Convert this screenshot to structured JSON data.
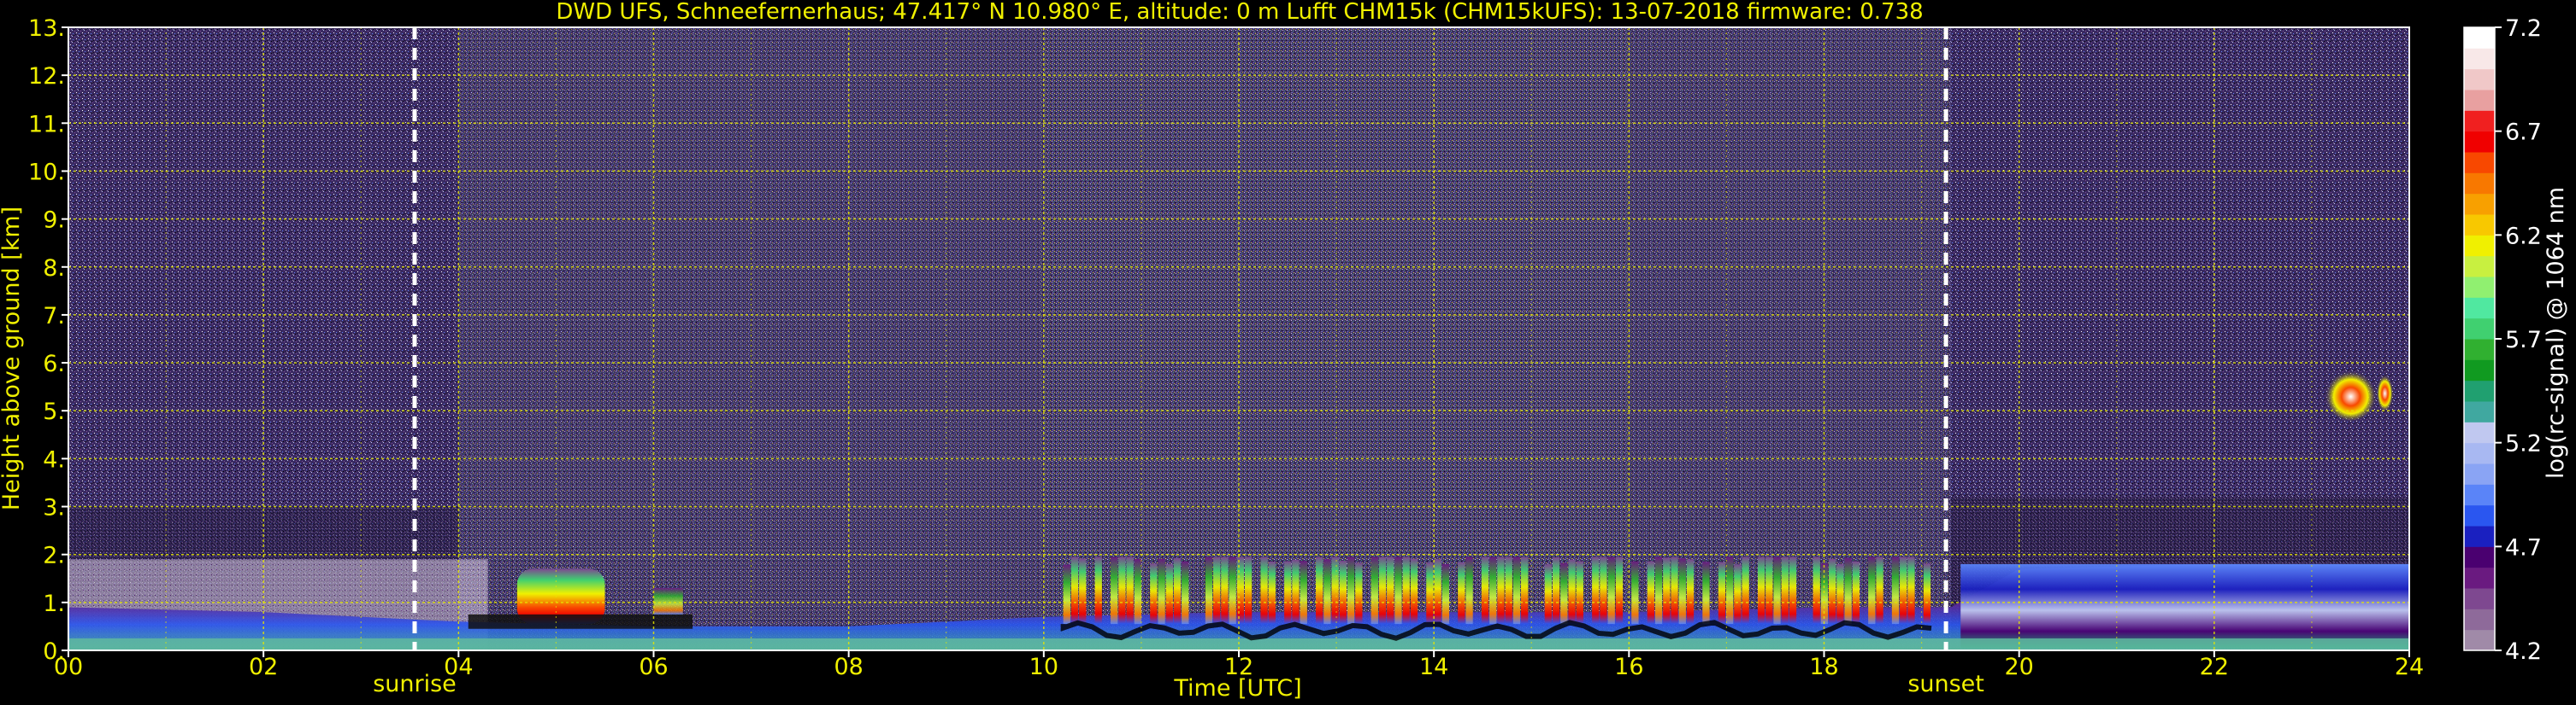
{
  "chart_data": {
    "type": "heatmap",
    "title": "DWD UFS, Schneefernerhaus; 47.417° N 10.980° E, altitude: 0 m    Lufft CHM15k (CHM15kUFS): 13-07-2018    firmware: 0.738",
    "xlabel": "Time [UTC]",
    "ylabel": "Height above ground [km]",
    "xlim": [
      0,
      24
    ],
    "ylim": [
      0,
      13
    ],
    "x_ticks": [
      0,
      2,
      4,
      6,
      8,
      10,
      12,
      14,
      16,
      18,
      20,
      22,
      24
    ],
    "x_tick_labels": [
      "00",
      "02",
      "04",
      "06",
      "08",
      "10",
      "12",
      "14",
      "16",
      "18",
      "20",
      "22",
      "24"
    ],
    "y_ticks": [
      0,
      1,
      2,
      3,
      4,
      5,
      6,
      7,
      8,
      9,
      10,
      11,
      12,
      13
    ],
    "y_tick_labels": [
      "0.",
      "1.",
      "2.",
      "3.",
      "4.",
      "5.",
      "6.",
      "7.",
      "8.",
      "9.",
      "10.",
      "11.",
      "12.",
      "13."
    ],
    "grid": true,
    "annotations": [
      {
        "text": "sunrise",
        "x": 3.55
      },
      {
        "text": "sunset",
        "x": 19.25
      }
    ],
    "colorbar": {
      "label": "log(rc-signal) @ 1064 nm",
      "min": 4.2,
      "max": 7.2,
      "ticks": [
        4.2,
        4.7,
        5.2,
        5.7,
        6.2,
        6.7,
        7.2
      ],
      "tick_labels": [
        "4.2",
        "4.7",
        "5.2",
        "5.7",
        "6.2",
        "6.7",
        "7.2"
      ],
      "colors": [
        "#a08aa8",
        "#8e6a9a",
        "#7e4890",
        "#6a1a80",
        "#4a0070",
        "#1a20c0",
        "#2a56f0",
        "#5a84f8",
        "#8aa4f4",
        "#a8b8f2",
        "#c0c8f0",
        "#40a8a0",
        "#20a070",
        "#109a20",
        "#30b030",
        "#40d070",
        "#50e8a0",
        "#90f070",
        "#c8f040",
        "#f0f000",
        "#f8c800",
        "#f8a000",
        "#f87800",
        "#f84800",
        "#f00000",
        "#f02020",
        "#e8a0a0",
        "#f0c8c8",
        "#f8e8e8",
        "#ffffff"
      ]
    },
    "layers": [
      {
        "name": "boundary_layer",
        "x": [
          0,
          2,
          4,
          6,
          8,
          10,
          12,
          14,
          16,
          18,
          19.3,
          20,
          22,
          24
        ],
        "top_km": [
          0.9,
          0.8,
          0.6,
          0.5,
          0.5,
          0.7,
          0.8,
          0.8,
          0.8,
          0.9,
          0.9,
          1.7,
          1.8,
          1.8
        ]
      },
      {
        "name": "cloud_band",
        "x": [
          4.5,
          5.5,
          10.3,
          19.0
        ],
        "base_km": [
          0.6,
          0.6,
          0.6,
          0.6
        ],
        "top_km": [
          1.7,
          1.7,
          1.9,
          1.9
        ]
      },
      {
        "name": "upper_cloud",
        "x": [
          23.2,
          23.9
        ],
        "base_km": [
          4.8,
          4.8
        ],
        "top_km": [
          5.9,
          5.9
        ]
      }
    ]
  }
}
